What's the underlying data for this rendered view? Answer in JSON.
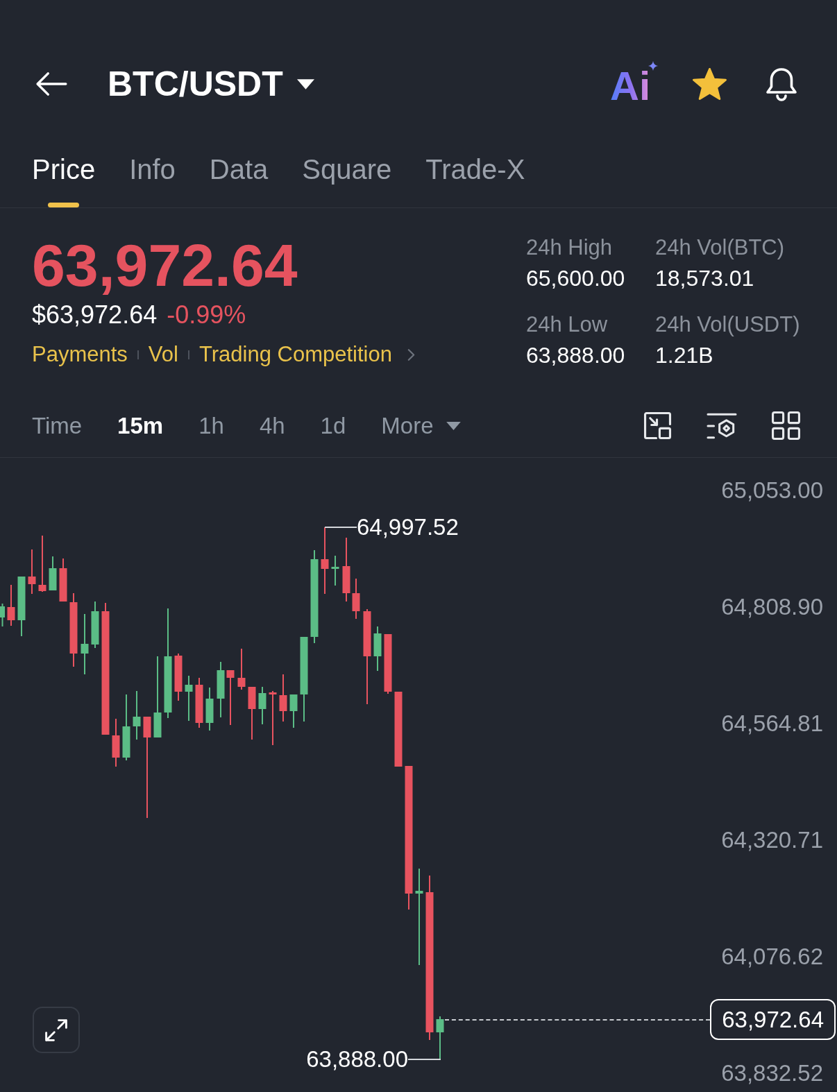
{
  "header": {
    "pair": "BTC/USDT",
    "ai_label": "Ai",
    "favorited": true
  },
  "tabs": [
    {
      "label": "Price",
      "selected": true
    },
    {
      "label": "Info",
      "selected": false
    },
    {
      "label": "Data",
      "selected": false
    },
    {
      "label": "Square",
      "selected": false
    },
    {
      "label": "Trade-X",
      "selected": false
    }
  ],
  "price": {
    "last": "63,972.64",
    "fiat": "$63,972.64",
    "change": "-0.99%"
  },
  "tags": [
    "Payments",
    "Vol",
    "Trading Competition"
  ],
  "stats": [
    {
      "label": "24h High",
      "value": "65,600.00"
    },
    {
      "label": "24h Vol(BTC)",
      "value": "18,573.01"
    },
    {
      "label": "24h Low",
      "value": "63,888.00"
    },
    {
      "label": "24h Vol(USDT)",
      "value": "1.21B"
    }
  ],
  "intervals": [
    {
      "label": "Time",
      "selected": false,
      "kind": "interval"
    },
    {
      "label": "15m",
      "selected": true,
      "kind": "interval"
    },
    {
      "label": "1h",
      "selected": false,
      "kind": "interval"
    },
    {
      "label": "4h",
      "selected": false,
      "kind": "interval"
    },
    {
      "label": "1d",
      "selected": false,
      "kind": "interval"
    },
    {
      "label": "More",
      "selected": false,
      "kind": "menu"
    }
  ],
  "chart": {
    "y_labels": [
      "65,053.00",
      "64,808.90",
      "64,564.81",
      "64,320.71",
      "64,076.62",
      "63,832.52"
    ],
    "high_label": "64,997.52",
    "low_label": "63,888.00",
    "last_price_label": "63,972.64"
  }
}
